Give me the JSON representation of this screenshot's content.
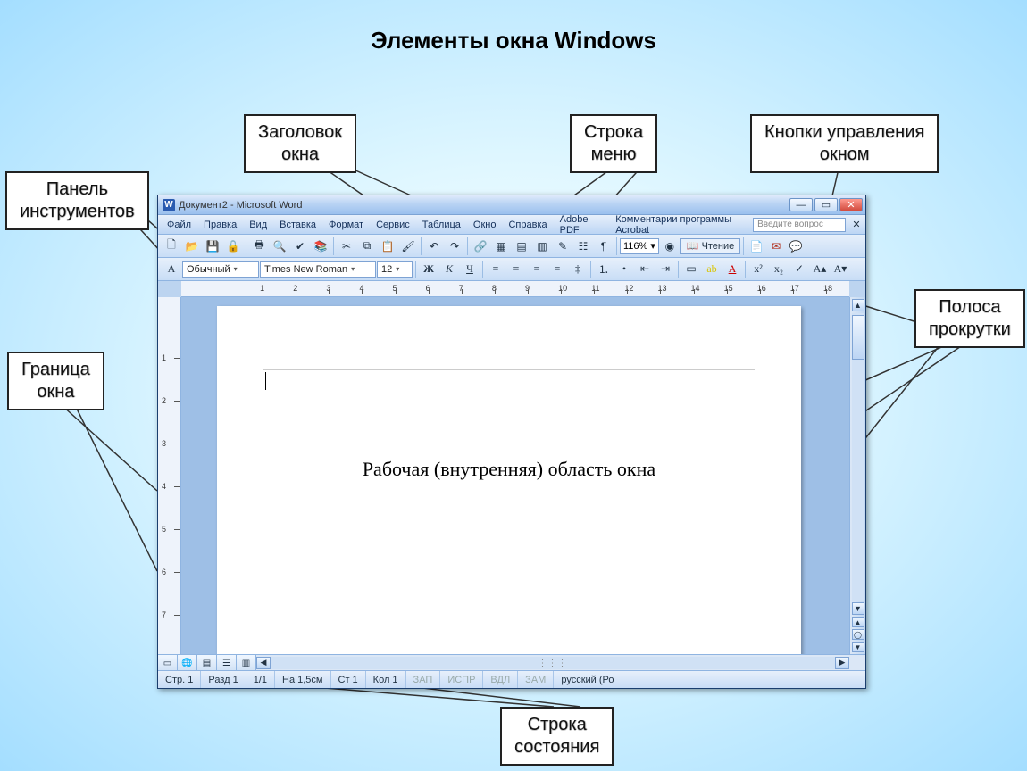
{
  "slide": {
    "title": "Элементы окна Windows"
  },
  "labels": {
    "titlebar": {
      "top": "Заголовок",
      "bot": "окна"
    },
    "menubar": {
      "top": "Строка",
      "bot": "меню"
    },
    "winbuttons": {
      "top": "Кнопки управления",
      "bot": "окном"
    },
    "toolbar": {
      "top": "Панель",
      "bot": "инструментов"
    },
    "scrollbar": {
      "top": "Полоса",
      "bot": "прокрутки"
    },
    "border": {
      "top": "Граница",
      "bot": "окна"
    },
    "statusbar": {
      "top": "Строка",
      "bot": "состояния"
    }
  },
  "window": {
    "title": "Документ2 - Microsoft Word",
    "word_icon": "W"
  },
  "menu": {
    "items": [
      "Файл",
      "Правка",
      "Вид",
      "Вставка",
      "Формат",
      "Сервис",
      "Таблица",
      "Окно",
      "Справка",
      "Adobe PDF",
      "Комментарии программы Acrobat"
    ],
    "question_placeholder": "Введите вопрос"
  },
  "format": {
    "style": "Обычный",
    "font": "Times New Roman",
    "size": "12",
    "zoom": "116%",
    "read": "Чтение"
  },
  "document": {
    "body_text": "Рабочая (внутренняя) область окна"
  },
  "ruler": {
    "h_max": 18
  },
  "status": {
    "page": "Стр. 1",
    "section": "Разд 1",
    "pages": "1/1",
    "at": "На 1,5см",
    "line": "Ст 1",
    "col": "Кол 1",
    "rec": "ЗАП",
    "trk": "ИСПР",
    "ext": "ВДЛ",
    "ovr": "ЗАМ",
    "lang": "русский (Ро"
  }
}
